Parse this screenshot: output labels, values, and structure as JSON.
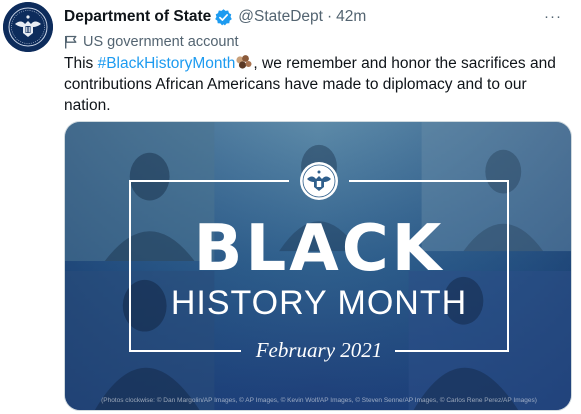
{
  "author": {
    "name": "Department of State",
    "handle": "@StateDept",
    "separator": "·",
    "time": "42m",
    "verified": true
  },
  "account_label": "US government account",
  "more_label": "···",
  "tweet": {
    "prefix": "This ",
    "hashtag": "#BlackHistoryMonth",
    "suffix": ", we remember and honor the sacrifices and contributions African Americans have made to diplomacy and to our nation."
  },
  "media": {
    "title_big": "BLACK",
    "title_sub": "HISTORY MONTH",
    "date": "February 2021",
    "credits": "(Photos clockwise: © Dan Margolin/AP Images, © AP Images, © Kevin Wolf/AP Images, © Steven Senne/AP Images, © Carlos Rene Perez/AP Images)"
  },
  "colors": {
    "link": "#1d9bf0",
    "text": "#0f1419",
    "muted": "#536471",
    "media_bg_top": "#3b6e8a",
    "media_bg_bottom": "#1f3f7a"
  },
  "icons": {
    "avatar": "state-department-seal-icon",
    "verified": "verified-badge-icon",
    "flag": "flag-icon",
    "emoji": "raised-fists-emoji-icon",
    "seal": "eagle-seal-icon"
  }
}
